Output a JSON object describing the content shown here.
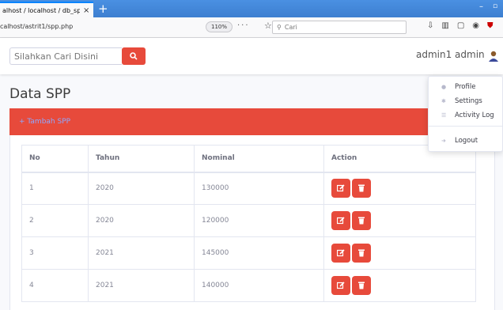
{
  "browser": {
    "tab_title": "alhost / localhost / db_spp",
    "tab_close": "×",
    "new_tab": "+",
    "window_min": "–",
    "window_restore": "▫",
    "url": "calhost/astrit1/spp.php",
    "zoom": "110%",
    "page_actions": "···",
    "search_placeholder": "Cari"
  },
  "topbar": {
    "search_placeholder": "Silahkan Cari Disini",
    "user_name": "admin1 admin"
  },
  "page": {
    "title": "Data SPP",
    "add_button": "+ Tambah SPP"
  },
  "table": {
    "headers": [
      "No",
      "Tahun",
      "Nominal",
      "Action"
    ],
    "rows": [
      {
        "no": "1",
        "tahun": "2020",
        "nominal": "130000"
      },
      {
        "no": "2",
        "tahun": "2020",
        "nominal": "120000"
      },
      {
        "no": "3",
        "tahun": "2021",
        "nominal": "145000"
      },
      {
        "no": "4",
        "tahun": "2021",
        "nominal": "140000"
      }
    ]
  },
  "dropdown": {
    "items": [
      "Profile",
      "Settings",
      "Activity Log",
      "Logout"
    ]
  },
  "colors": {
    "primary_red": "#e74a3b",
    "link_blue": "#8ea8ff"
  }
}
